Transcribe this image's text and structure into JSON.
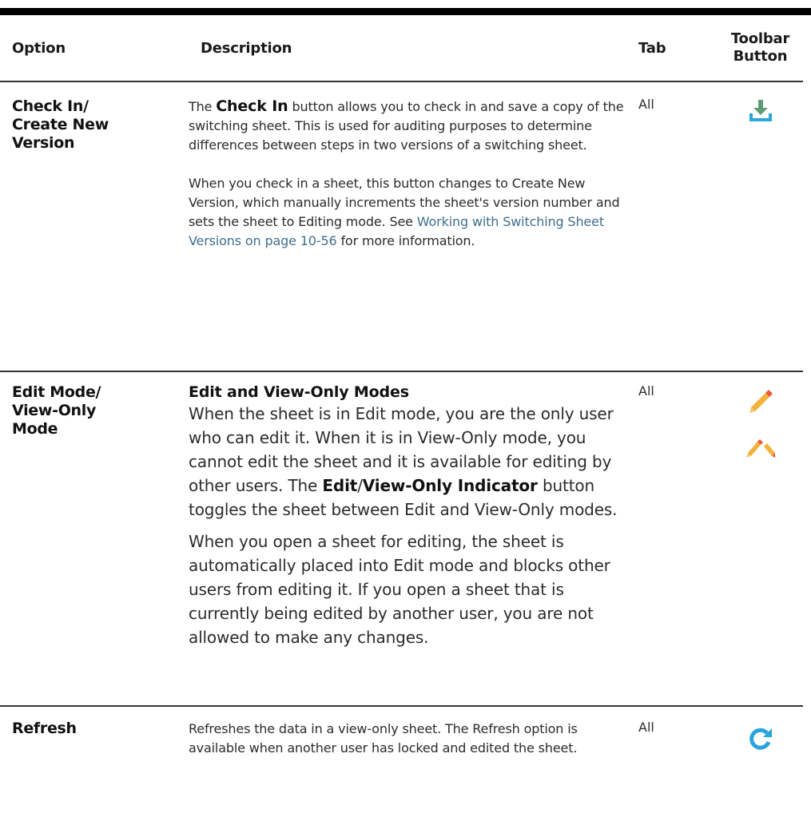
{
  "table": {
    "headers": {
      "option": "Option",
      "description": "Description",
      "tab": "Tab",
      "toolbar_line1": "Toolbar",
      "toolbar_line2": "Button"
    },
    "rows": [
      {
        "option_lines": [
          "Check In/",
          "Create New",
          "Version"
        ],
        "desc_p1_pre": "The ",
        "desc_p1_bold": "Check In",
        "desc_p1_post": " button allows you to check in and save a copy of the switching sheet. This is used for auditing purposes to determine differences between steps in two versions of a switching sheet.",
        "desc_p2_pre": "When you check in a sheet, this button changes to Create New Version, which manually increments the sheet's version number and sets the sheet to Editing mode. See ",
        "desc_p2_link": "Working with Switching Sheet Versions on page 10-56",
        "desc_p2_post": " for more information.",
        "tab": "All",
        "icon": "check-in-download-icon"
      },
      {
        "option_lines": [
          "Edit Mode/",
          "View-Only",
          "Mode"
        ],
        "desc_title": "Edit and View-Only Modes",
        "desc_p1": "When the sheet is in Edit mode, you are the only user who can edit it. When it is in View-Only mode, you cannot edit the sheet and it is available for editing by other users. The ",
        "desc_p1_bold1": "Edit",
        "desc_p1_sep": "/",
        "desc_p1_bold2": "View-Only Indicator",
        "desc_p1_post": " button toggles the sheet between Edit and View-Only modes.",
        "desc_p2": "When you open a sheet for editing, the sheet is automatically placed into Edit mode and blocks other users from editing it. If you open a sheet that is currently being edited by another user, you are not allowed to make any changes.",
        "tab": "All",
        "icon_edit": "edit-pencil-icon",
        "icon_view": "view-only-pencil-icon"
      },
      {
        "option_lines": [
          "Refresh"
        ],
        "desc": "Refreshes the data in a view-only sheet. The Refresh option is available when another user has locked and edited the sheet.",
        "tab": "All",
        "icon": "refresh-icon"
      }
    ]
  },
  "colors": {
    "download_arrow": "#5e9c77",
    "download_tray": "#29a7dc",
    "pencil_body": "#f3b23a",
    "pencil_tip": "#e85a3a",
    "refresh": "#2ba3dc",
    "link": "#3f6f8c"
  }
}
